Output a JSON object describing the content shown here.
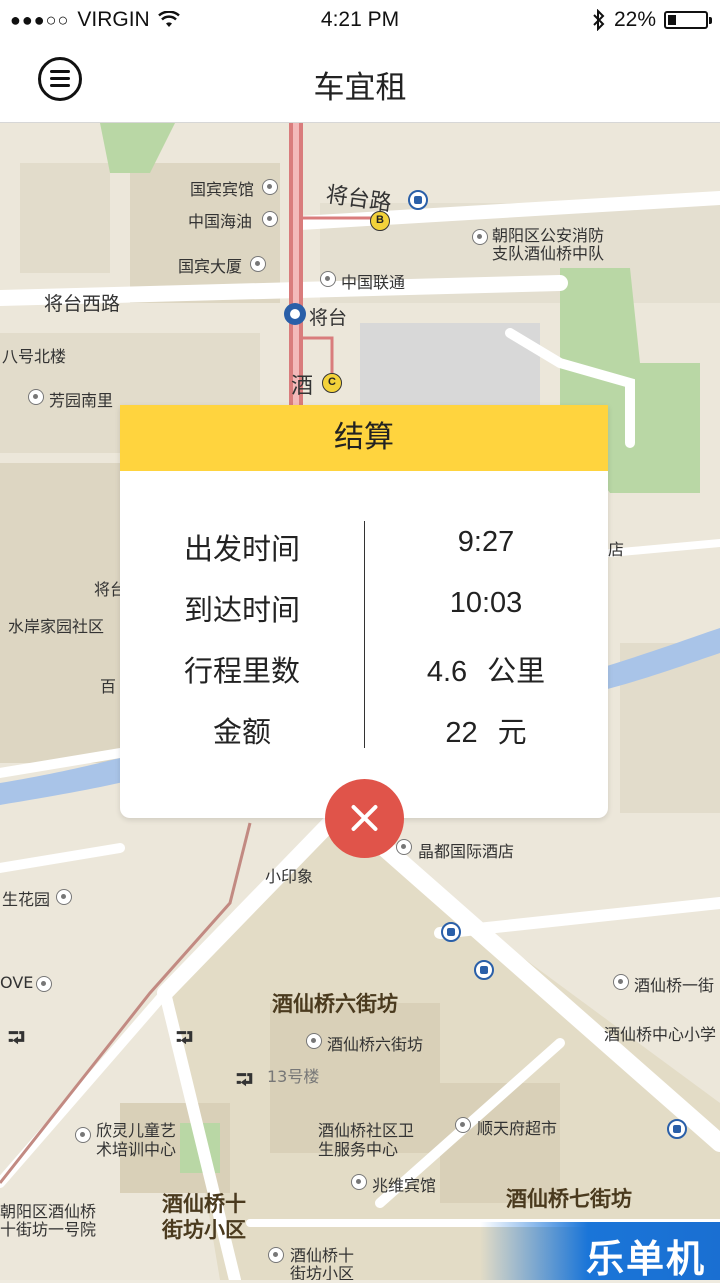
{
  "status_bar": {
    "signal": "●●●○○",
    "carrier": "VIRGIN",
    "time": "4:21 PM",
    "battery": "22%",
    "battery_level": 0.22
  },
  "nav": {
    "title": "车宜租",
    "menu_icon": "hamburger-menu-icon"
  },
  "map": {
    "labels": [
      "国宾宾馆",
      "中国海油",
      "国宾大厦",
      "将台路",
      "朝阳区公安消防",
      "支队酒仙桥中队",
      "中国联通",
      "将台西路",
      "将台",
      "八号北楼",
      "芳园南里",
      "酒",
      "将台",
      "水岸家园社区",
      "百",
      "店",
      "晶都国际酒店",
      "小印象",
      "生花园",
      "OVE",
      "酒仙桥六街坊",
      "酒仙桥六街坊",
      "酒仙桥一街",
      "酒仙桥中心小学",
      "13号楼",
      "欣灵儿童艺",
      "术培训中心",
      "酒仙桥社区卫",
      "生服务中心",
      "顺天府超市",
      "兆维宾馆",
      "酒仙桥十",
      "街坊小区",
      "酒仙桥七街坊",
      "朝阳区酒仙桥",
      "十街坊一号院",
      "酒仙桥十",
      "街坊小区"
    ],
    "metro_exits": [
      "B",
      "C"
    ]
  },
  "dialog": {
    "title": "结算",
    "rows": [
      {
        "label": "出发时间",
        "value": "9:27",
        "unit": ""
      },
      {
        "label": "到达时间",
        "value": "10:03",
        "unit": ""
      },
      {
        "label": "行程里数",
        "value": "4.6",
        "unit": "公里"
      },
      {
        "label": "金额",
        "value": "22",
        "unit": "元"
      }
    ]
  },
  "watermark": "乐单机",
  "colors": {
    "header_yellow": "#ffd43e",
    "close_red": "#e0544a",
    "map_bg": "#ece7da"
  }
}
